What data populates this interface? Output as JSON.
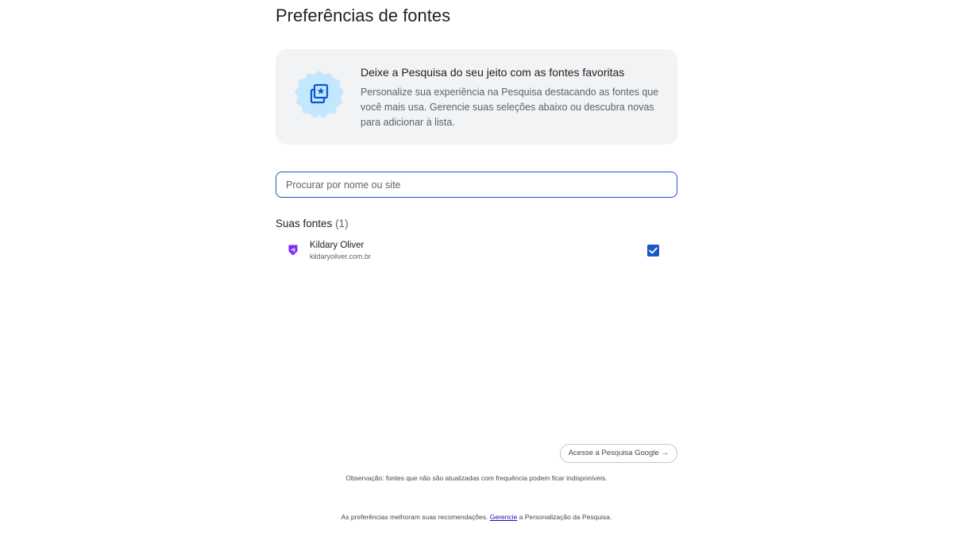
{
  "page": {
    "title": "Preferências de fontes"
  },
  "info_card": {
    "heading": "Deixe a Pesquisa do seu jeito com as fontes favoritas",
    "body": "Personalize sua experiência na Pesquisa destacando as fontes que você mais usa. Gerencie suas seleções abaixo ou descubra novas para adicionar à lista.",
    "icon": "star-collection-icon"
  },
  "search": {
    "placeholder": "Procurar por nome ou site",
    "value": ""
  },
  "sources_section": {
    "label": "Suas fontes",
    "count": "(1)",
    "items": [
      {
        "name": "Kildary Oliver",
        "site": "kildaryoliver.com.br",
        "checked": true,
        "icon": "kildary-oliver-logo-icon"
      }
    ]
  },
  "google_button": {
    "label": "Acesse a Pesquisa Google",
    "arrow": "→"
  },
  "footer": {
    "note": "Observação: fontes que não são atualizadas com frequência podem ficar indisponíveis.",
    "prefs_before": "As preferências melhoram suas recomendações. ",
    "prefs_link": "Gerencie",
    "prefs_after": " a Personalização da Pesquisa."
  },
  "colors": {
    "accent": "#1a57c7",
    "card_bg": "#f1f3f4",
    "badge_bg": "#c2e7ff",
    "badge_fg": "#0b57d0",
    "source_logo": "#7b2ff7"
  }
}
